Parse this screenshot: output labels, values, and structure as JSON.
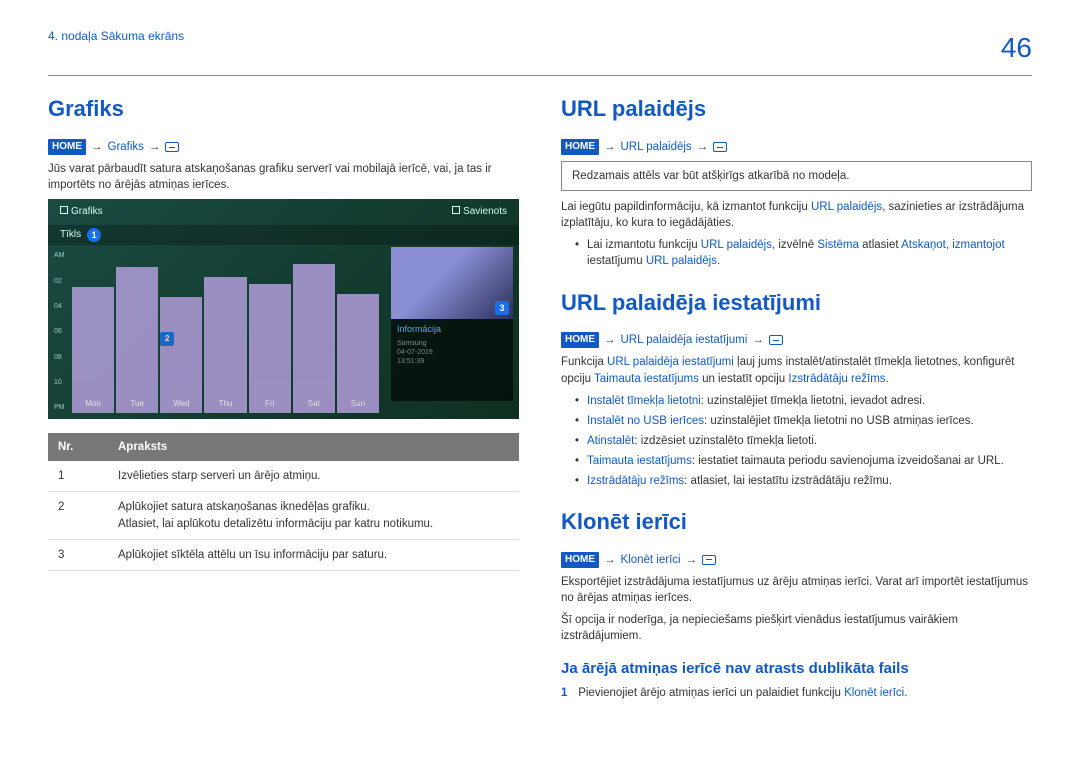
{
  "header": {
    "chapter": "4. nodaļa Sākuma ekrāns",
    "page_number": "46"
  },
  "nav": {
    "home_label": "HOME",
    "arrow": "→"
  },
  "left": {
    "heading": "Grafiks",
    "nav_item": "Grafiks",
    "intro": "Jūs varat pārbaudīt satura atskaņošanas grafiku serverī vai mobilajā ierīcē, vai, ja tas ir importēts no ārējās atmiņas ierīces.",
    "screenshot": {
      "title": "Grafiks",
      "connected": "Savienots",
      "network": "Tīkls",
      "info_title": "Informācija",
      "bars": [
        "Mon",
        "Tue",
        "Wed",
        "Thu",
        "Fri",
        "Sat",
        "Sun"
      ],
      "badge1": "1",
      "badge2": "2",
      "badge3": "3"
    },
    "table": {
      "col_nr": "Nr.",
      "col_desc": "Apraksts",
      "rows": [
        {
          "nr": "1",
          "desc": "Izvēlieties starp serveri un ārējo atmiņu."
        },
        {
          "nr": "2",
          "desc_a": "Aplūkojiet satura atskaņošanas iknedēļas grafiku.",
          "desc_b": "Atlasiet, lai aplūkotu detalizētu informāciju par katru notikumu."
        },
        {
          "nr": "3",
          "desc": "Aplūkojiet sīktēla attēlu un īsu informāciju par saturu."
        }
      ]
    }
  },
  "right": {
    "sec1": {
      "heading": "URL palaidējs",
      "nav_item": "URL palaidējs",
      "note": "Redzamais attēls var būt atšķirīgs atkarībā no modeļa.",
      "p1_a": "Lai iegūtu papildinformāciju, kā izmantot funkciju ",
      "p1_link": "URL palaidējs",
      "p1_b": ", sazinieties ar izstrādājuma izplatītāju, ko kura to iegādājāties.",
      "b1_a": "Lai izmantotu funkciju ",
      "b1_l1": "URL palaidējs",
      "b1_b": ", izvēlnē ",
      "b1_l2": "Sistēma",
      "b1_c": " atlasiet ",
      "b1_l3": "Atskaņot, izmantojot",
      "b1_d": " iestatījumu ",
      "b1_l4": "URL palaidējs",
      "b1_e": "."
    },
    "sec2": {
      "heading": "URL palaidēja iestatījumi",
      "nav_item": "URL palaidēja iestatījumi",
      "p1_a": "Funkcija ",
      "p1_l1": "URL palaidēja iestatījumi",
      "p1_b": " ļauj jums instalēt/atinstalēt tīmekļa lietotnes, konfigurēt opciju ",
      "p1_l2": "Taimauta iestatījums",
      "p1_c": " un iestatīt opciju ",
      "p1_l3": "Izstrādātāju režīms",
      "p1_d": ".",
      "bullets": [
        {
          "term": "Instalēt tīmekļa lietotni",
          "rest": ": uzinstalējiet tīmekļa lietotni, ievadot adresi."
        },
        {
          "term": "Instalēt no USB ierīces",
          "rest": ": uzinstalējiet tīmekļa lietotni no USB atmiņas ierīces."
        },
        {
          "term": "Atinstalēt",
          "rest": ": izdzēsiet uzinstalēto tīmekļa lietoti."
        },
        {
          "term": "Taimauta iestatījums",
          "rest": ": iestatiet taimauta periodu savienojuma izveidošanai ar URL."
        },
        {
          "term": "Izstrādātāju režīms",
          "rest": ": atlasiet, lai iestatītu izstrādātāju režīmu."
        }
      ]
    },
    "sec3": {
      "heading": "Klonēt ierīci",
      "nav_item": "Klonēt ierīci",
      "p1": "Eksportējiet izstrādājuma iestatījumus uz ārēju atmiņas ierīci. Varat arī importēt iestatījumus no ārējas atmiņas ierīces.",
      "p2": "Šī opcija ir noderīga, ja nepieciešams piešķirt vienādus iestatījumus vairākiem izstrādājumiem.",
      "sub_heading": "Ja ārējā atmiņas ierīcē nav atrasts dublikāta fails",
      "step1_num": "1",
      "step1_a": "Pievienojiet ārējo atmiņas ierīci un palaidiet funkciju ",
      "step1_link": "Klonēt ierīci",
      "step1_b": "."
    }
  }
}
